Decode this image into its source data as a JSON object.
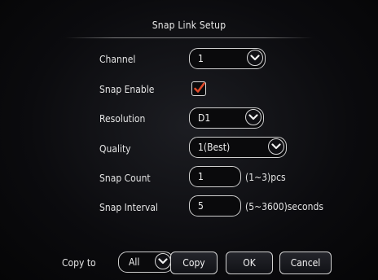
{
  "dialog": {
    "title": "Snap Link Setup"
  },
  "fields": {
    "channel": {
      "label": "Channel",
      "value": "1"
    },
    "snap_enable": {
      "label": "Snap Enable",
      "checked": true
    },
    "resolution": {
      "label": "Resolution",
      "value": "D1"
    },
    "quality": {
      "label": "Quality",
      "value": "1(Best)"
    },
    "snap_count": {
      "label": "Snap Count",
      "value": "1",
      "unit": "(1~3)pcs"
    },
    "snap_interval": {
      "label": "Snap Interval",
      "value": "5",
      "unit": "(5~3600)seconds"
    }
  },
  "footer": {
    "copy_to_label": "Copy to",
    "copy_to_value": "All",
    "copy_label": "Copy",
    "ok_label": "OK",
    "cancel_label": "Cancel"
  },
  "colors": {
    "background": "#050506",
    "checkmark": "#e04a2a",
    "border": "#cfcfcf",
    "text": "#e8e8e8"
  },
  "icons": {
    "dropdown": "chevron-down-icon",
    "check": "checkmark-icon"
  }
}
